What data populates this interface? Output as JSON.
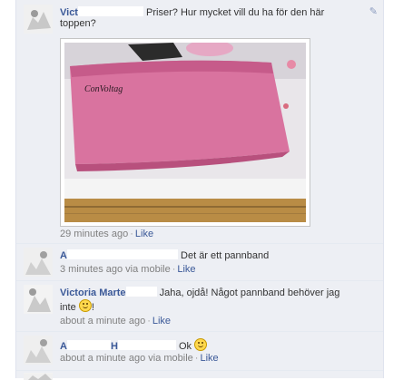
{
  "comments": [
    {
      "name_visible": "Vict",
      "text_line1": "Priser? Hur mycket vill du ha för den här",
      "text_line2": "toppen?",
      "time": "29 minutes ago",
      "like": "Like",
      "has_photo": true,
      "photo_caption": "ConVoltag"
    },
    {
      "name_visible": "A",
      "text": "Det är ett pannband",
      "time": "3 minutes ago",
      "via": "via mobile",
      "like": "Like"
    },
    {
      "name_visible": "Victoria Marte",
      "text_line1": "Jaha, ojdå! Något pannband behöver jag",
      "text_line2": "inte",
      "text_line2_suffix": "!",
      "time": "about a minute ago",
      "like": "Like"
    },
    {
      "name_visible": "A",
      "name_visible_2": "H",
      "text": "Ok",
      "time": "about a minute ago",
      "via": "via mobile",
      "like": "Like"
    }
  ],
  "colors": {
    "panel_bg": "#edeff4",
    "link": "#3b5998",
    "meta": "#808080",
    "headband": "#d9739f"
  },
  "icons": {
    "edit": "pencil-icon",
    "emoji": "smiley-icon"
  }
}
